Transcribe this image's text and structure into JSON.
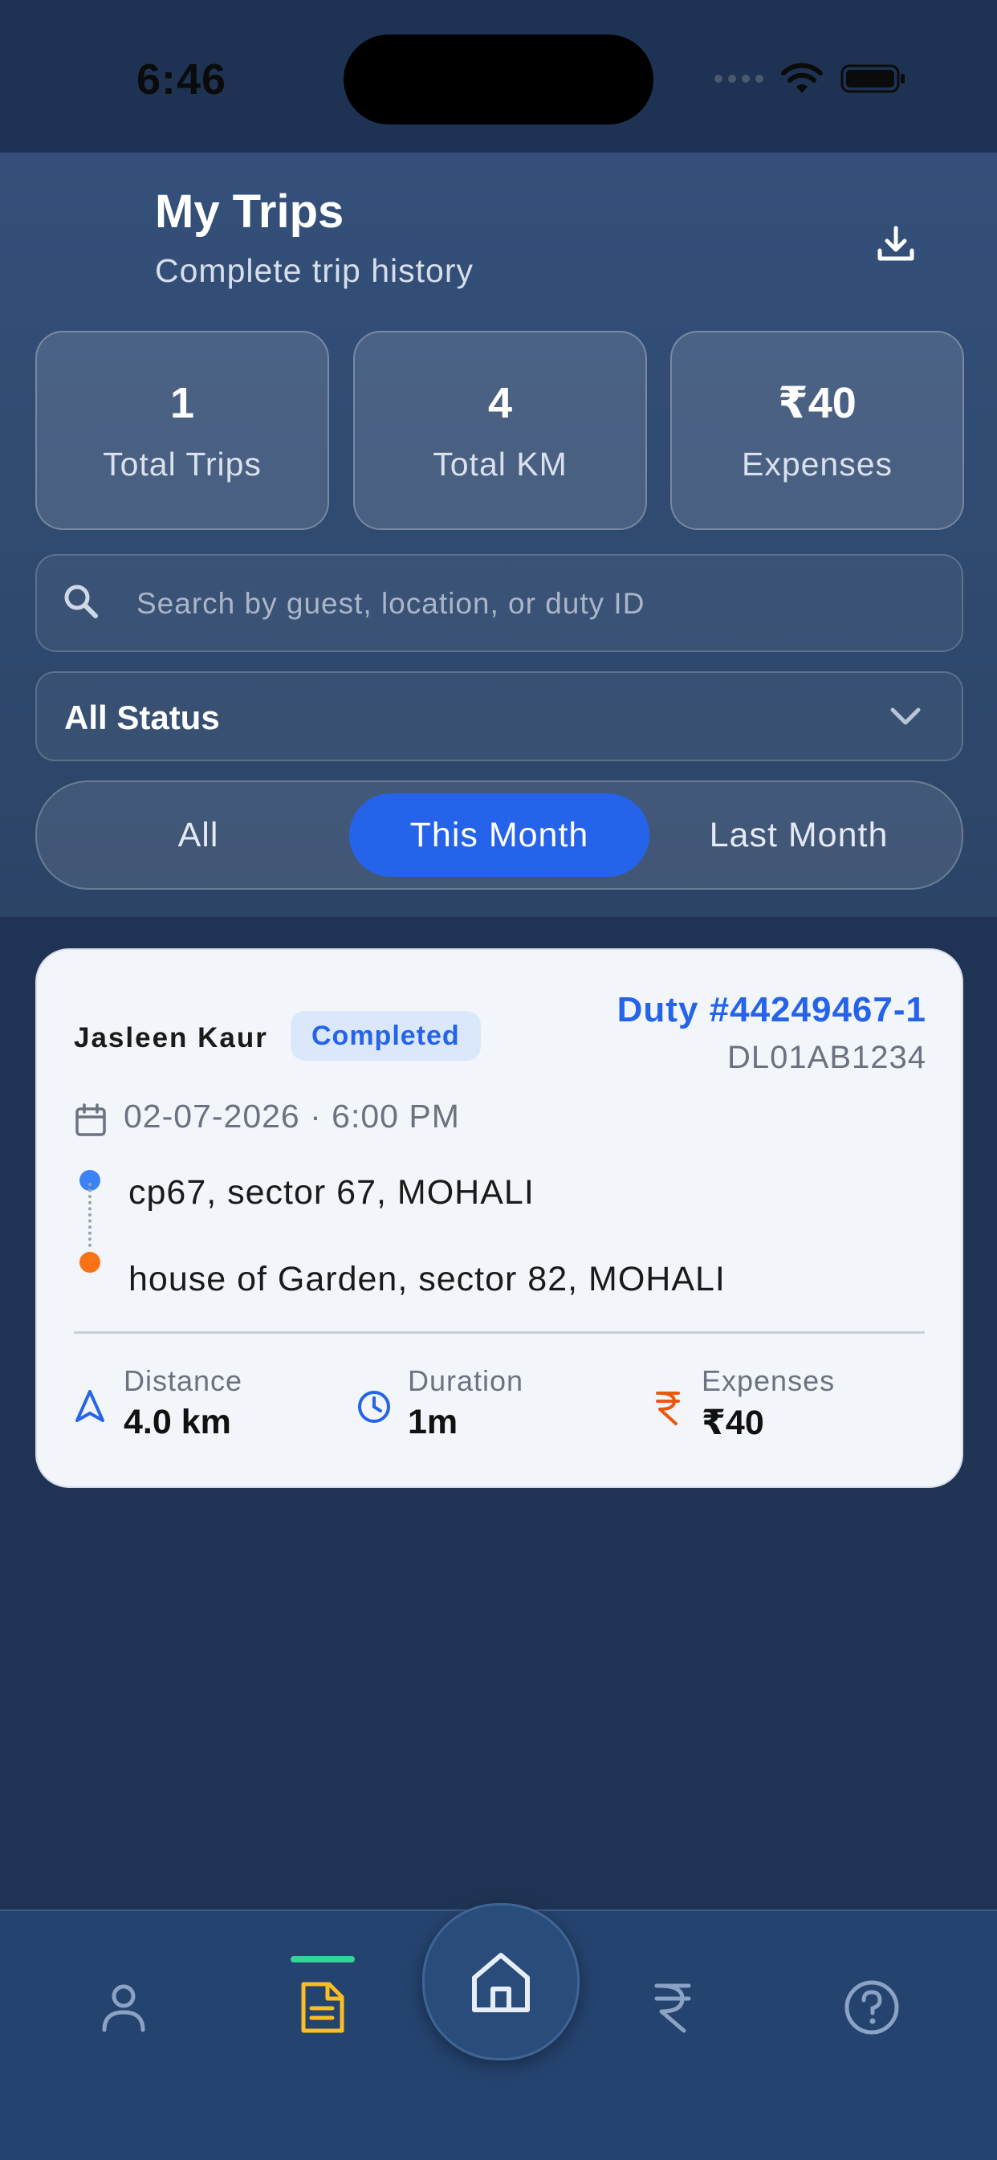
{
  "status_bar": {
    "time": "6:46"
  },
  "header": {
    "title": "My Trips",
    "subtitle": "Complete trip history",
    "download_icon": "download-icon"
  },
  "stats": [
    {
      "value": "1",
      "label": "Total Trips"
    },
    {
      "value": "4",
      "label": "Total KM"
    },
    {
      "value": "₹40",
      "label": "Expenses"
    }
  ],
  "search": {
    "placeholder": "Search by guest, location, or duty ID",
    "value": ""
  },
  "status_filter": {
    "selected": "All Status"
  },
  "period_tabs": [
    {
      "label": "All",
      "active": false
    },
    {
      "label": "This Month",
      "active": true
    },
    {
      "label": "Last Month",
      "active": false
    }
  ],
  "trips": [
    {
      "guest": "Jasleen  Kaur",
      "status": "Completed",
      "duty": "Duty #44249467-1",
      "vehicle": "DL01AB1234",
      "datetime": "02-07-2026 · 6:00 PM",
      "from": "cp67, sector 67, MOHALI",
      "to": "house of Garden, sector 82, MOHALI",
      "metrics": {
        "distance": {
          "label": "Distance",
          "value": "4.0 km"
        },
        "duration": {
          "label": "Duration",
          "value": "1m"
        },
        "expenses": {
          "label": "Expenses",
          "value": "₹40"
        }
      }
    }
  ],
  "bottom_nav": {
    "items": [
      "profile-icon",
      "trips-icon",
      "home-icon",
      "rupee-icon",
      "help-icon"
    ],
    "active": "trips-icon"
  },
  "colors": {
    "accent": "#2563eb",
    "header_bg": "#34507a",
    "page_bg": "#1f3454",
    "route_start": "#3b82f6",
    "route_end": "#f97316",
    "nav_active": "#fbbf24",
    "nav_indicator": "#34d399"
  }
}
